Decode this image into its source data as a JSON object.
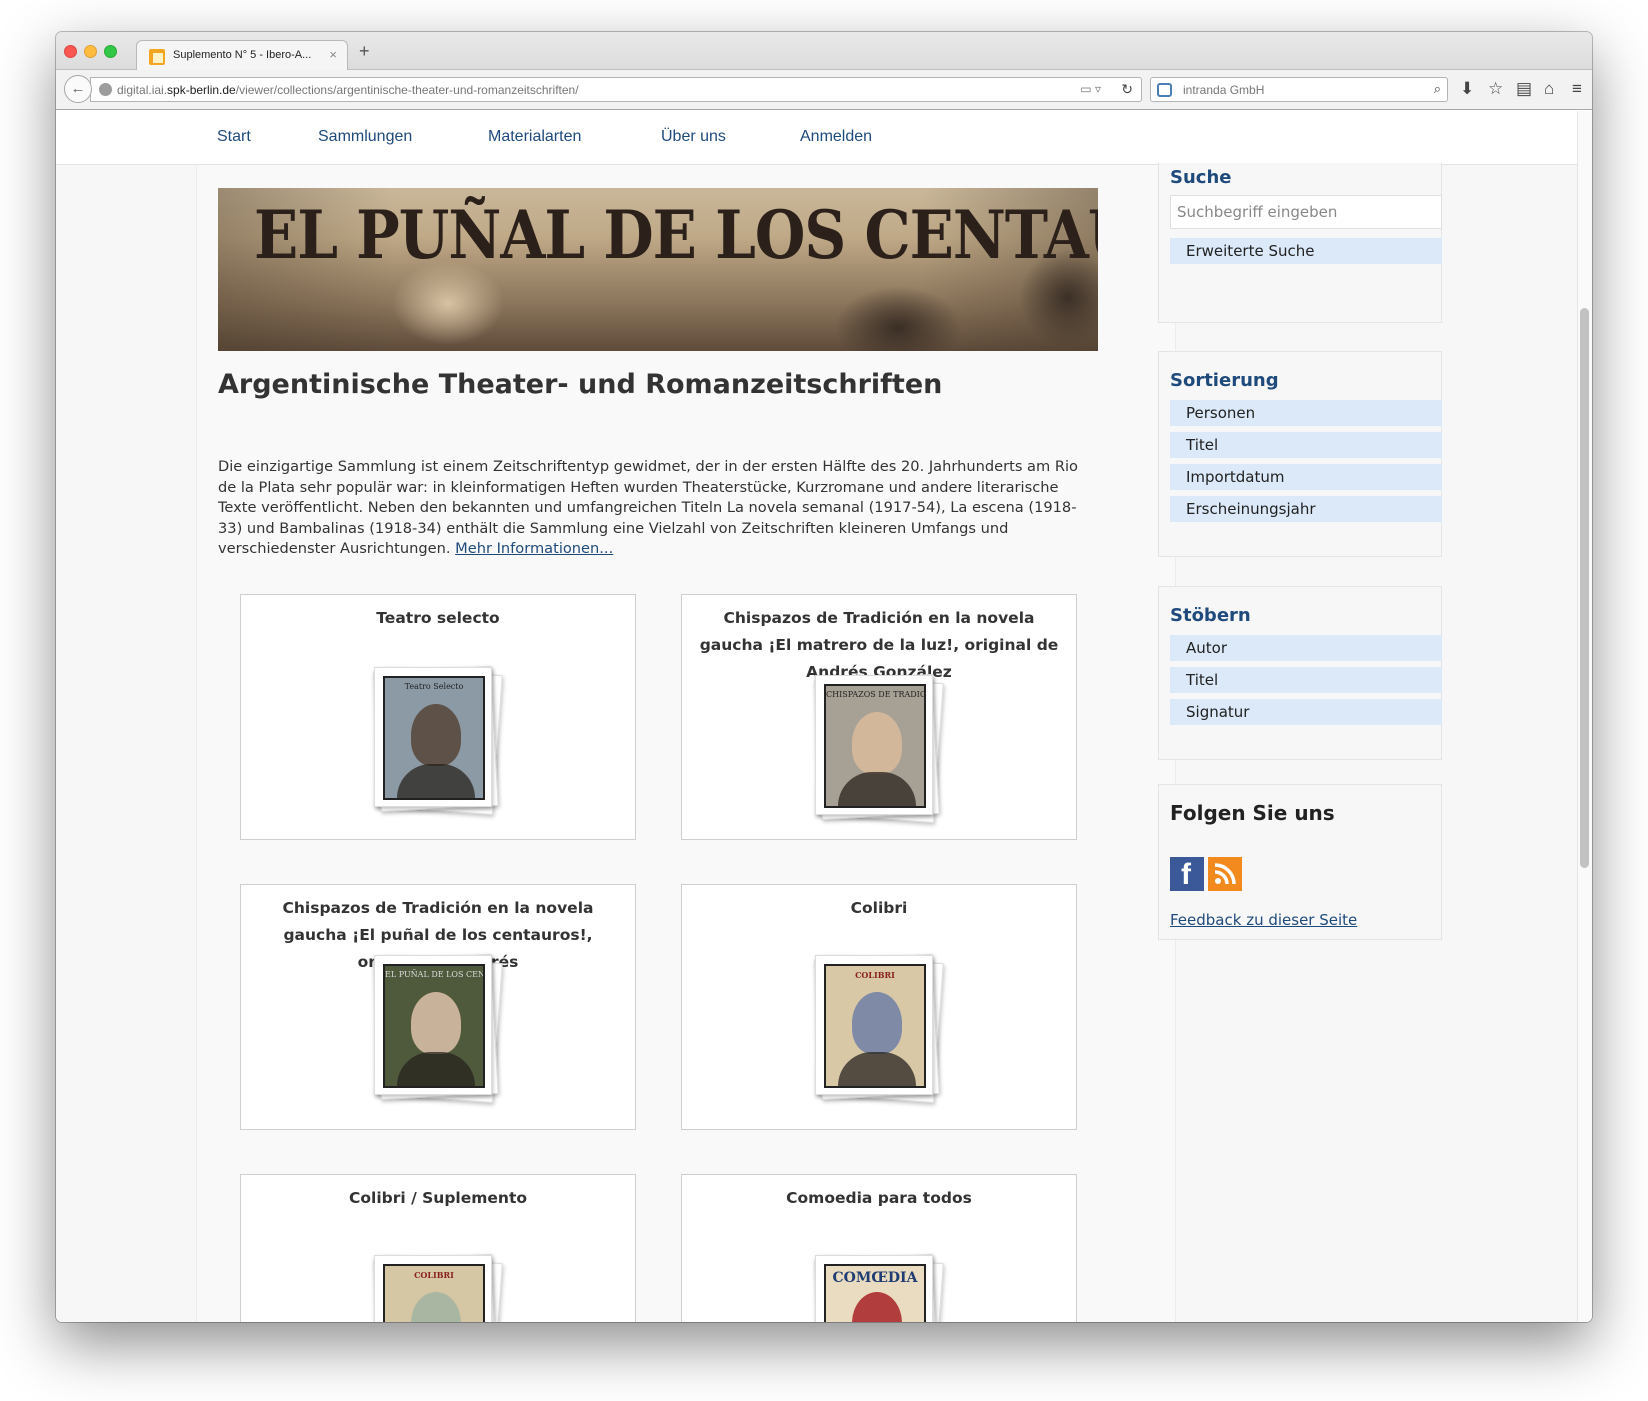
{
  "browser": {
    "tab_title": "Suplemento N° 5 - Ibero-A...",
    "tab_close": "×",
    "new_tab": "+",
    "url_domain_prefix": "digital.iai.",
    "url_domain": "spk-berlin.de",
    "url_path": "/viewer/collections/argentinische-theater-und-romanzeitschriften/",
    "search_engine": "intranda GmbH"
  },
  "nav": {
    "items": [
      "Start",
      "Sammlungen",
      "Materialarten",
      "Über uns",
      "Anmelden"
    ]
  },
  "banner": {
    "title": "EL PUÑAL DE LOS CENTAUROS!"
  },
  "collection": {
    "title": "Argentinische Theater- und Romanzeitschriften",
    "description": "Die einzigartige Sammlung ist einem Zeitschriftentyp gewidmet, der in der ersten Hälfte des 20. Jahrhunderts am Rio de la Plata sehr populär war: in kleinformatigen Heften wurden Theaterstücke, Kurzromane und andere literarische Texte veröffentlicht. Neben den bekannten und umfangreichen Titeln La novela semanal (1917-54), La escena (1918-33) und Bambalinas (1918-34) enthält die Sammlung eine Vielzahl von Zeitschriften kleineren Umfangs und verschiedenster Ausrichtungen.",
    "more_link": "Mehr Informationen..."
  },
  "cards": [
    {
      "title": "Teatro selecto",
      "cover_text": "Teatro Selecto",
      "cover_bg": "#8b9aa5",
      "portrait": "#5d5148"
    },
    {
      "title": "Chispazos de Tradición en la novela gaucha ¡El matrero de la luz!, original de Andrés González",
      "cover_text": "CHISPAZOS DE TRADICION",
      "cover_bg": "#a7a195",
      "portrait": "#d2b79b"
    },
    {
      "title": "Chispazos de Tradición en la novela gaucha ¡El puñal de los centauros!, original de Andrés",
      "cover_text": "EL PUÑAL DE LOS CENTAUROS",
      "cover_bg": "#4e5a3b",
      "portrait": "#c9b29a"
    },
    {
      "title": "Colibri",
      "cover_text": "COLIBRI",
      "cover_bg": "#d8c8a6",
      "portrait": "#7e8aa6"
    },
    {
      "title": "Colibri / Suplemento",
      "cover_text": "COLIBRI",
      "cover_bg": "#d6c7a4",
      "portrait": "#a9b6a2"
    },
    {
      "title": "Comoedia para todos",
      "cover_text": "COMŒDIA",
      "cover_bg": "#e9dcc0",
      "portrait": "#b23d3d"
    }
  ],
  "sidebar": {
    "search_title": "Suche",
    "search_placeholder": "Suchbegriff eingeben",
    "advanced_search": "Erweiterte Suche",
    "sort_title": "Sortierung",
    "sort_items": [
      "Personen",
      "Titel",
      "Importdatum",
      "Erscheinungsjahr"
    ],
    "browse_title": "Stöbern",
    "browse_items": [
      "Autor",
      "Titel",
      "Signatur"
    ],
    "follow_title": "Folgen Sie uns",
    "facebook_letter": "f",
    "feedback_link": "Feedback zu dieser Seite"
  }
}
